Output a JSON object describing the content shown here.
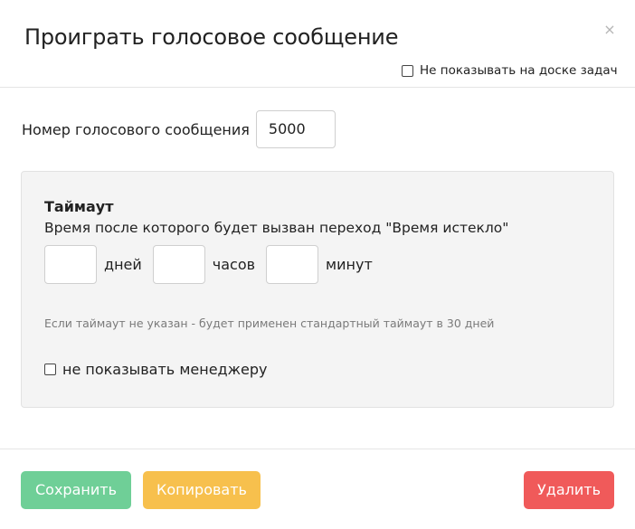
{
  "modal": {
    "title": "Проиграть голосовое сообщение",
    "close_glyph": "×",
    "close_icon": "close-icon",
    "hide_on_board_label": "Не показывать на доске задач"
  },
  "voice_message": {
    "label": "Номер голосового сообщения",
    "value": "5000"
  },
  "timeout": {
    "title": "Таймаут",
    "description": "Время после которого будет вызван переход \"Время истекло\"",
    "days_label": "дней",
    "hours_label": "часов",
    "minutes_label": "минут",
    "days_value": "",
    "hours_value": "",
    "minutes_value": "",
    "hint": "Если таймаут не указан - будет применен стандартный таймаут в 30 дней",
    "hide_from_manager_label": "не показывать менеджеру"
  },
  "footer": {
    "save_label": "Сохранить",
    "copy_label": "Копировать",
    "delete_label": "Удалить"
  },
  "colors": {
    "save": "#6fcf97",
    "copy": "#f7c04d",
    "delete": "#f05a5a",
    "panel_bg": "#f4f4f4",
    "hint_text": "#7a7a7a"
  }
}
